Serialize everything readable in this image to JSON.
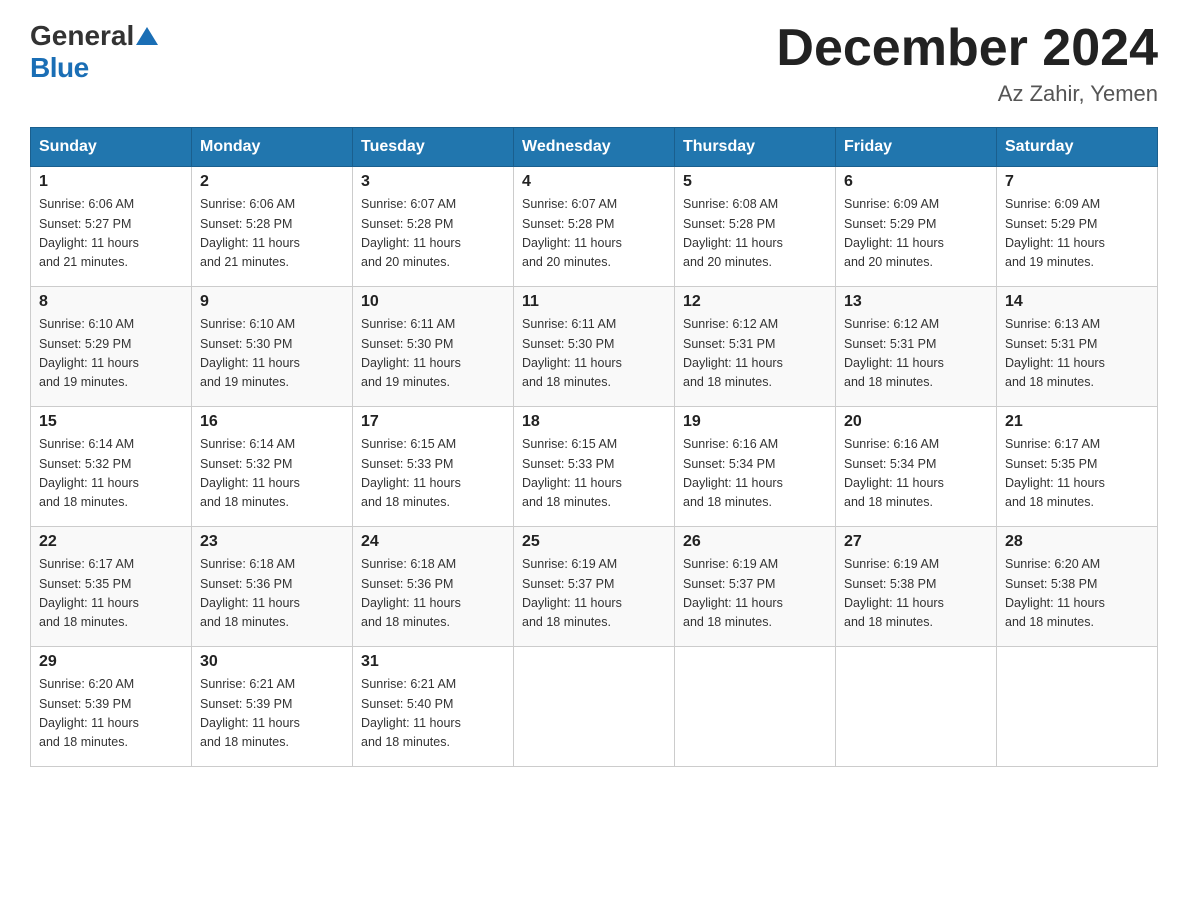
{
  "logo": {
    "general": "General",
    "blue": "Blue"
  },
  "title": "December 2024",
  "location": "Az Zahir, Yemen",
  "days_header": [
    "Sunday",
    "Monday",
    "Tuesday",
    "Wednesday",
    "Thursday",
    "Friday",
    "Saturday"
  ],
  "weeks": [
    [
      {
        "day": "1",
        "sunrise": "6:06 AM",
        "sunset": "5:27 PM",
        "daylight": "11 hours and 21 minutes."
      },
      {
        "day": "2",
        "sunrise": "6:06 AM",
        "sunset": "5:28 PM",
        "daylight": "11 hours and 21 minutes."
      },
      {
        "day": "3",
        "sunrise": "6:07 AM",
        "sunset": "5:28 PM",
        "daylight": "11 hours and 20 minutes."
      },
      {
        "day": "4",
        "sunrise": "6:07 AM",
        "sunset": "5:28 PM",
        "daylight": "11 hours and 20 minutes."
      },
      {
        "day": "5",
        "sunrise": "6:08 AM",
        "sunset": "5:28 PM",
        "daylight": "11 hours and 20 minutes."
      },
      {
        "day": "6",
        "sunrise": "6:09 AM",
        "sunset": "5:29 PM",
        "daylight": "11 hours and 20 minutes."
      },
      {
        "day": "7",
        "sunrise": "6:09 AM",
        "sunset": "5:29 PM",
        "daylight": "11 hours and 19 minutes."
      }
    ],
    [
      {
        "day": "8",
        "sunrise": "6:10 AM",
        "sunset": "5:29 PM",
        "daylight": "11 hours and 19 minutes."
      },
      {
        "day": "9",
        "sunrise": "6:10 AM",
        "sunset": "5:30 PM",
        "daylight": "11 hours and 19 minutes."
      },
      {
        "day": "10",
        "sunrise": "6:11 AM",
        "sunset": "5:30 PM",
        "daylight": "11 hours and 19 minutes."
      },
      {
        "day": "11",
        "sunrise": "6:11 AM",
        "sunset": "5:30 PM",
        "daylight": "11 hours and 18 minutes."
      },
      {
        "day": "12",
        "sunrise": "6:12 AM",
        "sunset": "5:31 PM",
        "daylight": "11 hours and 18 minutes."
      },
      {
        "day": "13",
        "sunrise": "6:12 AM",
        "sunset": "5:31 PM",
        "daylight": "11 hours and 18 minutes."
      },
      {
        "day": "14",
        "sunrise": "6:13 AM",
        "sunset": "5:31 PM",
        "daylight": "11 hours and 18 minutes."
      }
    ],
    [
      {
        "day": "15",
        "sunrise": "6:14 AM",
        "sunset": "5:32 PM",
        "daylight": "11 hours and 18 minutes."
      },
      {
        "day": "16",
        "sunrise": "6:14 AM",
        "sunset": "5:32 PM",
        "daylight": "11 hours and 18 minutes."
      },
      {
        "day": "17",
        "sunrise": "6:15 AM",
        "sunset": "5:33 PM",
        "daylight": "11 hours and 18 minutes."
      },
      {
        "day": "18",
        "sunrise": "6:15 AM",
        "sunset": "5:33 PM",
        "daylight": "11 hours and 18 minutes."
      },
      {
        "day": "19",
        "sunrise": "6:16 AM",
        "sunset": "5:34 PM",
        "daylight": "11 hours and 18 minutes."
      },
      {
        "day": "20",
        "sunrise": "6:16 AM",
        "sunset": "5:34 PM",
        "daylight": "11 hours and 18 minutes."
      },
      {
        "day": "21",
        "sunrise": "6:17 AM",
        "sunset": "5:35 PM",
        "daylight": "11 hours and 18 minutes."
      }
    ],
    [
      {
        "day": "22",
        "sunrise": "6:17 AM",
        "sunset": "5:35 PM",
        "daylight": "11 hours and 18 minutes."
      },
      {
        "day": "23",
        "sunrise": "6:18 AM",
        "sunset": "5:36 PM",
        "daylight": "11 hours and 18 minutes."
      },
      {
        "day": "24",
        "sunrise": "6:18 AM",
        "sunset": "5:36 PM",
        "daylight": "11 hours and 18 minutes."
      },
      {
        "day": "25",
        "sunrise": "6:19 AM",
        "sunset": "5:37 PM",
        "daylight": "11 hours and 18 minutes."
      },
      {
        "day": "26",
        "sunrise": "6:19 AM",
        "sunset": "5:37 PM",
        "daylight": "11 hours and 18 minutes."
      },
      {
        "day": "27",
        "sunrise": "6:19 AM",
        "sunset": "5:38 PM",
        "daylight": "11 hours and 18 minutes."
      },
      {
        "day": "28",
        "sunrise": "6:20 AM",
        "sunset": "5:38 PM",
        "daylight": "11 hours and 18 minutes."
      }
    ],
    [
      {
        "day": "29",
        "sunrise": "6:20 AM",
        "sunset": "5:39 PM",
        "daylight": "11 hours and 18 minutes."
      },
      {
        "day": "30",
        "sunrise": "6:21 AM",
        "sunset": "5:39 PM",
        "daylight": "11 hours and 18 minutes."
      },
      {
        "day": "31",
        "sunrise": "6:21 AM",
        "sunset": "5:40 PM",
        "daylight": "11 hours and 18 minutes."
      },
      null,
      null,
      null,
      null
    ]
  ],
  "labels": {
    "sunrise": "Sunrise: ",
    "sunset": "Sunset: ",
    "daylight": "Daylight: "
  }
}
